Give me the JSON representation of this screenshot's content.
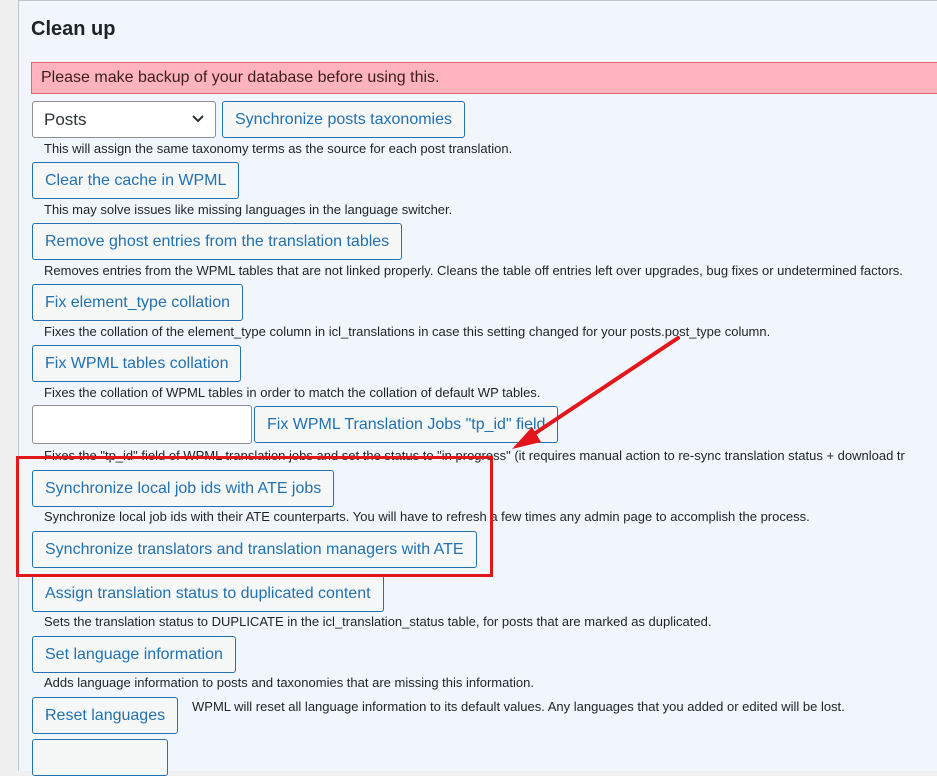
{
  "page": {
    "title": "Clean up",
    "warning": "Please make backup of your database before using this."
  },
  "taxonomy": {
    "select_value": "Posts",
    "sync_button": "Synchronize posts taxonomies",
    "sync_desc": "This will assign the same taxonomy terms as the source for each post translation."
  },
  "actions": {
    "clear_cache": {
      "label": "Clear the cache in WPML",
      "desc": "This may solve issues like missing languages in the language switcher."
    },
    "remove_ghost": {
      "label": "Remove ghost entries from the translation tables",
      "desc": "Removes entries from the WPML tables that are not linked properly. Cleans the table off entries left over upgrades, bug fixes or undetermined factors."
    },
    "fix_element_type": {
      "label": "Fix element_type collation",
      "desc": "Fixes the collation of the element_type column in icl_translations in case this setting changed for your posts.post_type column."
    },
    "fix_tables": {
      "label": "Fix WPML tables collation",
      "desc": "Fixes the collation of WPML tables in order to match the collation of default WP tables."
    },
    "fix_tp_id": {
      "label": "Fix WPML Translation Jobs \"tp_id\" field",
      "input_value": "",
      "desc": "Fixes the \"tp_id\" field of WPML translation jobs and set the status to \"in progress\" (it requires manual action to re-sync translation status + download tr"
    },
    "sync_job_ids": {
      "label": "Synchronize local job ids with ATE jobs",
      "desc": "Synchronize local job ids with their ATE counterparts. You will have to refresh a few times any admin page to accomplish the process."
    },
    "sync_translators": {
      "label": "Synchronize translators and translation managers with ATE"
    },
    "assign_status": {
      "label": "Assign translation status to duplicated content",
      "desc": "Sets the translation status to DUPLICATE in the icl_translation_status table, for posts that are marked as duplicated."
    },
    "set_language": {
      "label": "Set language information",
      "desc": "Adds language information to posts and taxonomies that are missing this information."
    },
    "reset_languages": {
      "label": "Reset languages",
      "desc": "WPML will reset all language information to its default values. Any languages that you added or edited will be lost."
    }
  },
  "annotation": {
    "color": "#e3161c"
  }
}
